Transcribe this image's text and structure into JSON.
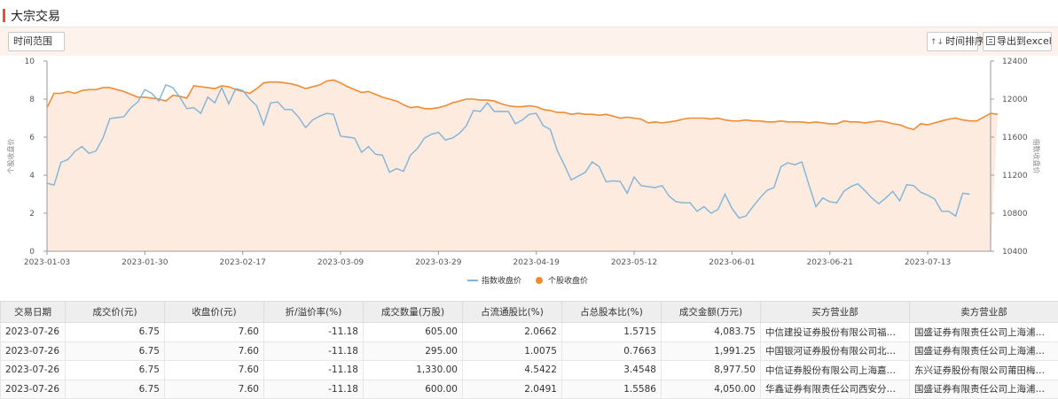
{
  "header": {
    "title": "大宗交易"
  },
  "toolbar": {
    "range_label": "时间范围",
    "sort_label": "时间排序",
    "export_label": "导出到excel"
  },
  "chart_data": {
    "type": "line",
    "title": "",
    "x": [
      "2023-01-03",
      "2023-01-04",
      "2023-01-05",
      "2023-01-06",
      "2023-01-09",
      "2023-01-10",
      "2023-01-11",
      "2023-01-12",
      "2023-01-13",
      "2023-01-16",
      "2023-01-17",
      "2023-01-18",
      "2023-01-19",
      "2023-01-20",
      "2023-01-30",
      "2023-01-31",
      "2023-02-01",
      "2023-02-02",
      "2023-02-03",
      "2023-02-06",
      "2023-02-07",
      "2023-02-08",
      "2023-02-09",
      "2023-02-10",
      "2023-02-13",
      "2023-02-14",
      "2023-02-15",
      "2023-02-16",
      "2023-02-17",
      "2023-02-20",
      "2023-02-21",
      "2023-02-22",
      "2023-02-23",
      "2023-02-24",
      "2023-02-27",
      "2023-02-28",
      "2023-03-01",
      "2023-03-02",
      "2023-03-03",
      "2023-03-06",
      "2023-03-07",
      "2023-03-08",
      "2023-03-09",
      "2023-03-10",
      "2023-03-13",
      "2023-03-14",
      "2023-03-15",
      "2023-03-16",
      "2023-03-17",
      "2023-03-20",
      "2023-03-21",
      "2023-03-22",
      "2023-03-23",
      "2023-03-24",
      "2023-03-27",
      "2023-03-28",
      "2023-03-29",
      "2023-03-30",
      "2023-03-31",
      "2023-04-03",
      "2023-04-04",
      "2023-04-06",
      "2023-04-07",
      "2023-04-10",
      "2023-04-11",
      "2023-04-12",
      "2023-04-13",
      "2023-04-14",
      "2023-04-17",
      "2023-04-18",
      "2023-04-19",
      "2023-04-20",
      "2023-04-21",
      "2023-04-24",
      "2023-04-25",
      "2023-04-26",
      "2023-04-27",
      "2023-04-28",
      "2023-05-04",
      "2023-05-05",
      "2023-05-08",
      "2023-05-09",
      "2023-05-10",
      "2023-05-11",
      "2023-05-12",
      "2023-05-15",
      "2023-05-16",
      "2023-05-17",
      "2023-05-18",
      "2023-05-19",
      "2023-05-22",
      "2023-05-23",
      "2023-05-24",
      "2023-05-25",
      "2023-05-26",
      "2023-05-29",
      "2023-05-30",
      "2023-05-31",
      "2023-06-01",
      "2023-06-02",
      "2023-06-05",
      "2023-06-06",
      "2023-06-07",
      "2023-06-08",
      "2023-06-09",
      "2023-06-12",
      "2023-06-13",
      "2023-06-14",
      "2023-06-15",
      "2023-06-16",
      "2023-06-19",
      "2023-06-20",
      "2023-06-21",
      "2023-06-26",
      "2023-06-27",
      "2023-06-28",
      "2023-06-29",
      "2023-06-30",
      "2023-07-03",
      "2023-07-04",
      "2023-07-05",
      "2023-07-06",
      "2023-07-07",
      "2023-07-10",
      "2023-07-11",
      "2023-07-12",
      "2023-07-13",
      "2023-07-14",
      "2023-07-17",
      "2023-07-18",
      "2023-07-19",
      "2023-07-20",
      "2023-07-21",
      "2023-07-24",
      "2023-07-25",
      "2023-07-26"
    ],
    "x_ticks": [
      "2023-01-03",
      "2023-01-30",
      "2023-02-17",
      "2023-03-09",
      "2023-03-29",
      "2023-04-19",
      "2023-05-12",
      "2023-06-01",
      "2023-06-21",
      "2023-07-13"
    ],
    "y_left": {
      "label": "个股收盘价",
      "min": 0,
      "max": 10,
      "ticks": [
        0,
        2,
        4,
        6,
        8,
        10
      ]
    },
    "y_right": {
      "label": "指数收盘价",
      "min": 10400,
      "max": 12400,
      "ticks": [
        10400,
        10800,
        11200,
        11600,
        12000,
        12400
      ]
    },
    "series": [
      {
        "name": "指数收盘价",
        "axis": "right",
        "color": "#7fb3d9",
        "values": [
          11115,
          11095,
          11335,
          11365,
          11450,
          11500,
          11430,
          11455,
          11590,
          11795,
          11805,
          11815,
          11910,
          11970,
          12100,
          12060,
          11980,
          12150,
          12120,
          12020,
          11900,
          11910,
          11850,
          12020,
          11960,
          12120,
          11950,
          12110,
          12090,
          12000,
          11930,
          11730,
          11960,
          11970,
          11890,
          11890,
          11810,
          11700,
          11780,
          11820,
          11850,
          11840,
          11610,
          11600,
          11590,
          11440,
          11500,
          11420,
          11410,
          11230,
          11270,
          11240,
          11410,
          11480,
          11590,
          11630,
          11650,
          11570,
          11590,
          11640,
          11720,
          11880,
          11870,
          11960,
          11870,
          11870,
          11870,
          11740,
          11780,
          11840,
          11850,
          11720,
          11680,
          11460,
          11310,
          11150,
          11190,
          11230,
          11340,
          11290,
          11130,
          11140,
          11135,
          11010,
          11180,
          11090,
          11080,
          11070,
          11090,
          10980,
          10920,
          10910,
          10910,
          10820,
          10870,
          10800,
          10840,
          11000,
          10850,
          10750,
          10770,
          10870,
          10960,
          11040,
          11070,
          11290,
          11330,
          11310,
          11340,
          11100,
          10870,
          10960,
          10920,
          10910,
          11030,
          11080,
          11110,
          11040,
          10960,
          10900,
          10960,
          11030,
          10930,
          11100,
          11090,
          11020,
          10990,
          10950,
          10820,
          10820,
          10770,
          11010,
          11000
        ]
      },
      {
        "name": "个股收盘价",
        "axis": "left",
        "color": "#ef8c33",
        "values": [
          7.55,
          8.3,
          8.3,
          8.4,
          8.3,
          8.45,
          8.5,
          8.5,
          8.6,
          8.6,
          8.5,
          8.4,
          8.25,
          8.1,
          8.1,
          8.05,
          8.0,
          7.9,
          8.2,
          8.15,
          8.05,
          8.7,
          8.65,
          8.6,
          8.55,
          8.7,
          8.65,
          8.5,
          8.4,
          8.3,
          8.55,
          8.85,
          8.9,
          8.9,
          8.85,
          8.8,
          8.7,
          8.55,
          8.65,
          8.75,
          8.95,
          9.0,
          8.85,
          8.65,
          8.5,
          8.35,
          8.4,
          8.25,
          8.1,
          8.0,
          7.9,
          7.7,
          7.55,
          7.6,
          7.5,
          7.5,
          7.55,
          7.65,
          7.8,
          7.9,
          8.0,
          8.0,
          7.95,
          7.95,
          7.9,
          7.75,
          7.65,
          7.6,
          7.6,
          7.65,
          7.6,
          7.45,
          7.4,
          7.3,
          7.3,
          7.2,
          7.25,
          7.2,
          7.2,
          7.15,
          7.2,
          7.1,
          7.0,
          7.05,
          7.0,
          6.95,
          6.75,
          6.8,
          6.75,
          6.8,
          6.85,
          6.95,
          7.0,
          7.0,
          7.0,
          6.95,
          7.0,
          6.9,
          6.85,
          6.85,
          6.9,
          6.85,
          6.85,
          6.8,
          6.8,
          6.85,
          6.8,
          6.8,
          6.8,
          6.75,
          6.8,
          6.75,
          6.7,
          6.7,
          6.85,
          6.8,
          6.8,
          6.75,
          6.8,
          6.85,
          6.8,
          6.7,
          6.65,
          6.5,
          6.4,
          6.7,
          6.65,
          6.75,
          6.85,
          6.95,
          7.0,
          6.9,
          6.85,
          6.85,
          7.05,
          7.25,
          7.2
        ]
      }
    ],
    "legend": [
      "指数收盘价",
      "个股收盘价"
    ],
    "legend_position": "bottom-center",
    "grid": false
  },
  "table": {
    "columns": [
      "交易日期",
      "成交价(元)",
      "收盘价(元)",
      "折/溢价率(%)",
      "成交数量(万股)",
      "占流通股比(%)",
      "占总股本比(%)",
      "成交金额(万元)",
      "买方营业部",
      "卖方营业部"
    ],
    "rows": [
      [
        "2023-07-26",
        "6.75",
        "7.60",
        "-11.18",
        "605.00",
        "2.0662",
        "1.5715",
        "4,083.75",
        "中信建投证券股份有限公司福州湖...",
        "国盛证券有限责任公司上海浦东新..."
      ],
      [
        "2023-07-26",
        "6.75",
        "7.60",
        "-11.18",
        "295.00",
        "1.0075",
        "0.7663",
        "1,991.25",
        "中国银河证券股份有限公司北京知...",
        "国盛证券有限责任公司上海浦东新..."
      ],
      [
        "2023-07-26",
        "6.75",
        "7.60",
        "-11.18",
        "1,330.00",
        "4.5422",
        "3.4548",
        "8,977.50",
        "中信证券股份有限公司上海嘉定证...",
        "东兴证券股份有限公司莆田梅园东..."
      ],
      [
        "2023-07-26",
        "6.75",
        "7.60",
        "-11.18",
        "600.00",
        "2.0491",
        "1.5586",
        "4,050.00",
        "华鑫证券有限责任公司西安分公司",
        "国盛证券有限责任公司上海浦东新..."
      ]
    ]
  }
}
